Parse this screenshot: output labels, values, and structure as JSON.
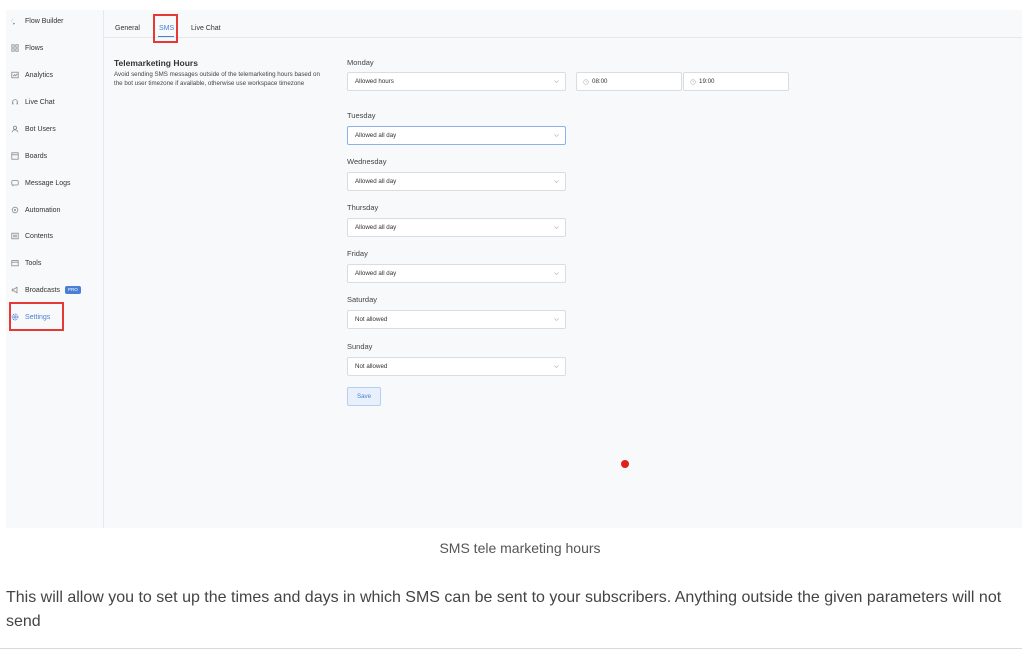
{
  "sidebar": {
    "items": [
      {
        "label": "Flow Builder",
        "icon": "chat-bubble-icon"
      },
      {
        "label": "Flows",
        "icon": "grid-icon"
      },
      {
        "label": "Analytics",
        "icon": "analytics-icon"
      },
      {
        "label": "Live Chat",
        "icon": "headset-icon"
      },
      {
        "label": "Bot Users",
        "icon": "user-icon"
      },
      {
        "label": "Boards",
        "icon": "board-icon"
      },
      {
        "label": "Message Logs",
        "icon": "message-icon"
      },
      {
        "label": "Automation",
        "icon": "automation-icon"
      },
      {
        "label": "Contents",
        "icon": "contents-icon"
      },
      {
        "label": "Tools",
        "icon": "tools-icon"
      },
      {
        "label": "Broadcasts",
        "icon": "megaphone-icon",
        "badge": "PRO"
      },
      {
        "label": "Settings",
        "icon": "gear-icon",
        "active": true
      }
    ]
  },
  "tabs": [
    {
      "label": "General"
    },
    {
      "label": "SMS",
      "active": true
    },
    {
      "label": "Live Chat"
    }
  ],
  "section": {
    "title": "Telemarketing Hours",
    "description": "Avoid sending SMS messages outside of the telemarketing hours based on the bot user timezone if available, otherwise use workspace timezone"
  },
  "days": [
    {
      "day": "Monday",
      "value": "Allowed hours",
      "start": "08:00",
      "end": "19:00"
    },
    {
      "day": "Tuesday",
      "value": "Allowed all day"
    },
    {
      "day": "Wednesday",
      "value": "Allowed all day"
    },
    {
      "day": "Thursday",
      "value": "Allowed all day"
    },
    {
      "day": "Friday",
      "value": "Allowed all day"
    },
    {
      "day": "Saturday",
      "value": "Not allowed"
    },
    {
      "day": "Sunday",
      "value": "Not allowed"
    }
  ],
  "save_label": "Save",
  "caption": "SMS tele marketing hours",
  "paragraph": "This will allow you to set up the times and days in which SMS can be sent to your subscribers. Anything outside the given parameters will not send",
  "colors": {
    "accent": "#4a7fd6",
    "highlight_box": "#e53935",
    "dot": "#e0201b"
  }
}
